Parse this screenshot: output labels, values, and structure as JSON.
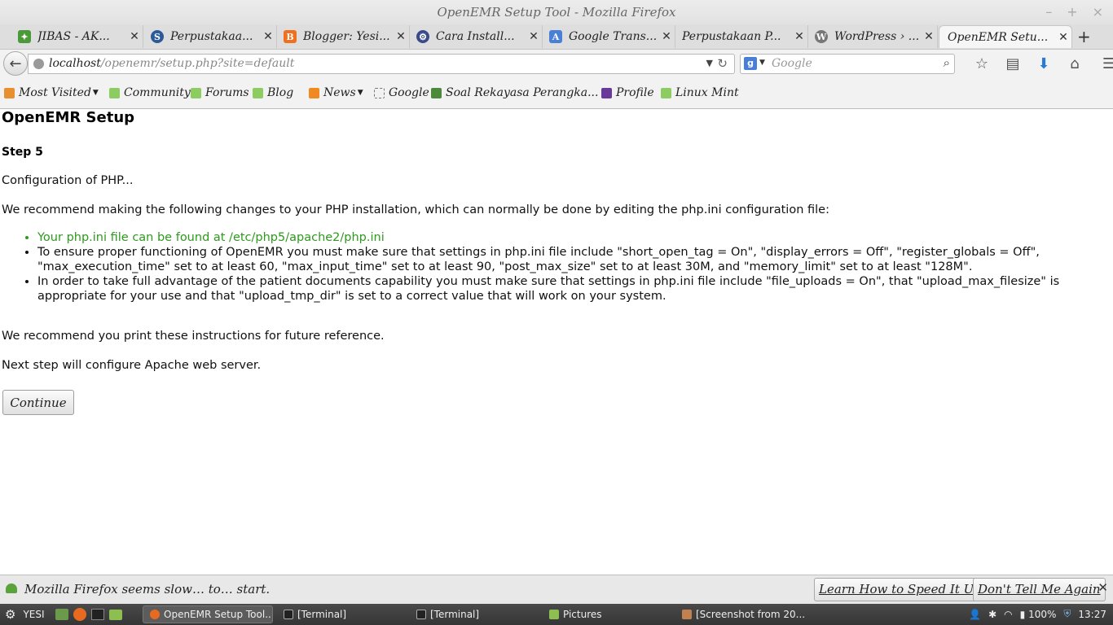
{
  "window": {
    "title": "OpenEMR Setup Tool - Mozilla Firefox"
  },
  "tabs": [
    {
      "label": "JIBAS - AK...",
      "icon": "jibas-favicon",
      "color": "#4a9a3a"
    },
    {
      "label": "Perpustakaa...",
      "icon": "globe-favicon",
      "color": "#2a5a9a"
    },
    {
      "label": "Blogger: Yesi...",
      "icon": "blogger-favicon",
      "color": "#f07020"
    },
    {
      "label": "Cara Install...",
      "icon": "site-favicon",
      "color": "#3a4a8a"
    },
    {
      "label": "Google Trans...",
      "icon": "translate-favicon",
      "color": "#4a7fd8"
    },
    {
      "label": "Perpustakaan P...",
      "icon": "",
      "color": ""
    },
    {
      "label": "WordPress › ...",
      "icon": "wordpress-favicon",
      "color": "#666666"
    },
    {
      "label": "OpenEMR Setu...",
      "icon": "",
      "color": "",
      "active": true
    }
  ],
  "navbar": {
    "url_host": "localhost",
    "url_path": "/openemr/setup.php?site=default",
    "search_placeholder": "Google"
  },
  "bookmarks": [
    {
      "label": "Most Visited",
      "icon": "most-visited-icon",
      "dropdown": true
    },
    {
      "label": "Community",
      "icon": "mint-icon"
    },
    {
      "label": "Forums",
      "icon": "mint-icon"
    },
    {
      "label": "Blog",
      "icon": "mint-icon"
    },
    {
      "label": "News",
      "icon": "rss-icon",
      "dropdown": true
    },
    {
      "label": "Google",
      "icon": "blank-page-icon"
    },
    {
      "label": "Soal Rekayasa Perangka...",
      "icon": "site-icon"
    },
    {
      "label": "Profile",
      "icon": "profile-icon"
    },
    {
      "label": "Linux Mint",
      "icon": "mint-icon"
    }
  ],
  "page": {
    "heading": "OpenEMR Setup",
    "step": "Step 5",
    "config_text": "Configuration of PHP...",
    "recommend_text": "We recommend making the following changes to your PHP installation, which can normally be done by editing the php.ini configuration file:",
    "bullets": [
      "Your php.ini file can be found at /etc/php5/apache2/php.ini",
      "To ensure proper functioning of OpenEMR you must make sure that settings in php.ini file include \"short_open_tag = On\", \"display_errors = Off\", \"register_globals = Off\", \"max_execution_time\" set to at least 60, \"max_input_time\" set to at least 90, \"post_max_size\" set to at least 30M, and \"memory_limit\" set to at least \"128M\".",
      "In order to take full advantage of the patient documents capability you must make sure that settings in php.ini file include \"file_uploads = On\", that \"upload_max_filesize\" is appropriate for your use and that \"upload_tmp_dir\" is set to a correct value that will work on your system."
    ],
    "print_text": "We recommend you print these instructions for future reference.",
    "next_text": "Next step will configure Apache web server.",
    "continue_label": "Continue"
  },
  "notification": {
    "message": "Mozilla Firefox seems slow… to… start.",
    "learn_label": "Learn How to Speed It Up",
    "dont_label": "Don't Tell Me Again"
  },
  "taskbar": {
    "user": "YESI",
    "tasks": [
      {
        "label": "OpenEMR Setup Tool...",
        "active": true
      },
      {
        "label": "[Terminal]"
      },
      {
        "label": "[Terminal]"
      },
      {
        "label": "Pictures"
      },
      {
        "label": "[Screenshot from 20..."
      }
    ],
    "battery": "100%",
    "clock": "13:27"
  },
  "colors": {
    "link_green": "#2c9a1c",
    "taskbar": "#3e3e3e"
  }
}
